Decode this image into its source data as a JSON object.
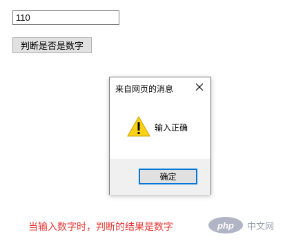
{
  "page": {
    "input_value": "110",
    "check_button_label": "判断是否是数字"
  },
  "dialog": {
    "title": "来自网页的消息",
    "close_glyph": "×",
    "message": "输入正确",
    "ok_label": "确定",
    "icon": "warning-icon"
  },
  "caption": {
    "text": "当输入数字时，判断的结果是数字"
  },
  "watermark": {
    "logo_text": "php",
    "site_text": "中文网"
  },
  "colors": {
    "caption": "#e53935",
    "ok_border": "#0078d7",
    "warning_fill": "#fcd116"
  }
}
